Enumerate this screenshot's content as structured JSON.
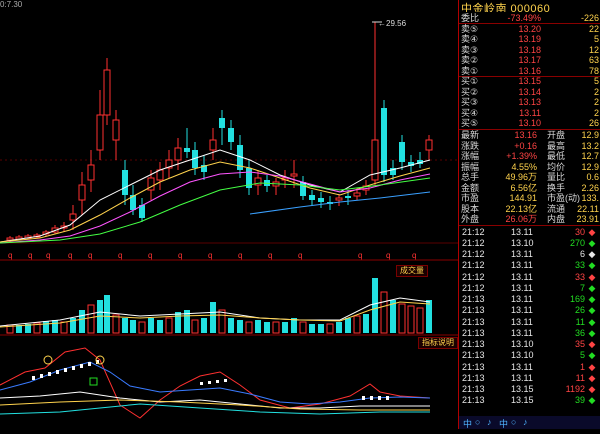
{
  "corner_time": "0:7.30",
  "peak_label": "29.56",
  "volume_tag": "成交量",
  "indicator_tag": "指标说明",
  "q_marks": [
    "q",
    "q",
    "q",
    "q",
    "q",
    "q",
    "q",
    "q",
    "q",
    "q",
    "q",
    "q",
    "q",
    "q",
    "q"
  ],
  "header": {
    "title": "中金岭南 000060"
  },
  "orderbook": [
    {
      "label": "委比",
      "value": "-73.49%",
      "vcls": "red",
      "right": "-226"
    },
    {
      "label": "卖⑤",
      "value": "13.20",
      "vcls": "red",
      "right": "22"
    },
    {
      "label": "卖④",
      "value": "13.19",
      "vcls": "red",
      "right": "5"
    },
    {
      "label": "卖③",
      "value": "13.18",
      "vcls": "red",
      "right": "12"
    },
    {
      "label": "卖②",
      "value": "13.17",
      "vcls": "red",
      "right": "63"
    },
    {
      "label": "卖①",
      "value": "13.16",
      "vcls": "red",
      "right": "78"
    },
    {
      "label": "买①",
      "value": "13.15",
      "vcls": "red",
      "right": "5"
    },
    {
      "label": "买②",
      "value": "13.14",
      "vcls": "red",
      "right": "2"
    },
    {
      "label": "买③",
      "value": "13.13",
      "vcls": "red",
      "right": "2"
    },
    {
      "label": "买④",
      "value": "13.11",
      "vcls": "red",
      "right": "2"
    },
    {
      "label": "买⑤",
      "value": "13.10",
      "vcls": "red",
      "right": "26"
    }
  ],
  "quote": [
    {
      "l1": "最新",
      "v1": "13.16",
      "c1": "red",
      "l2": "开盘",
      "v2": "12.9"
    },
    {
      "l1": "涨跌",
      "v1": "+0.16",
      "c1": "red",
      "l2": "最高",
      "v2": "13.2"
    },
    {
      "l1": "涨幅",
      "v1": "+1.39%",
      "c1": "red",
      "l2": "最低",
      "v2": "12.7"
    },
    {
      "l1": "振幅",
      "v1": "4.55%",
      "c1": "yellow",
      "l2": "均价",
      "v2": "12.9"
    },
    {
      "l1": "总手",
      "v1": "49.96万",
      "c1": "yellow",
      "l2": "量比",
      "v2": "0.6"
    },
    {
      "l1": "金额",
      "v1": "6.56亿",
      "c1": "yellow",
      "l2": "换手",
      "v2": "2.26"
    },
    {
      "l1": "市盈",
      "v1": "144.91",
      "c1": "yellow",
      "l2": "市盈(动)",
      "v2": "133."
    },
    {
      "l1": "股本",
      "v1": "22.13亿",
      "c1": "yellow",
      "l2": "流通",
      "v2": "22.11"
    },
    {
      "l1": "外盘",
      "v1": "26.06万",
      "c1": "red",
      "l2": "内盘",
      "v2": "23.91"
    }
  ],
  "ticks": [
    {
      "time": "21:12",
      "price": "13.11",
      "vol": "30",
      "vcls": "red",
      "arrow": "◆",
      "acls": "red"
    },
    {
      "time": "21:12",
      "price": "13.10",
      "vol": "270",
      "vcls": "green",
      "arrow": "◆",
      "acls": "green"
    },
    {
      "time": "21:12",
      "price": "13.11",
      "vol": "6",
      "vcls": "white",
      "arrow": "◆",
      "acls": "white"
    },
    {
      "time": "21:12",
      "price": "13.11",
      "vol": "33",
      "vcls": "green",
      "arrow": "◆",
      "acls": "green"
    },
    {
      "time": "21:12",
      "price": "13.11",
      "vol": "33",
      "vcls": "red",
      "arrow": "◆",
      "acls": "red"
    },
    {
      "time": "21:12",
      "price": "13.11",
      "vol": "7",
      "vcls": "green",
      "arrow": "◆",
      "acls": "green"
    },
    {
      "time": "21:13",
      "price": "13.11",
      "vol": "169",
      "vcls": "green",
      "arrow": "◆",
      "acls": "green"
    },
    {
      "time": "21:13",
      "price": "13.11",
      "vol": "26",
      "vcls": "green",
      "arrow": "◆",
      "acls": "green"
    },
    {
      "time": "21:13",
      "price": "13.11",
      "vol": "11",
      "vcls": "green",
      "arrow": "◆",
      "acls": "green"
    },
    {
      "time": "21:13",
      "price": "13.11",
      "vol": "36",
      "vcls": "green",
      "arrow": "◆",
      "acls": "green"
    },
    {
      "time": "21:13",
      "price": "13.10",
      "vol": "35",
      "vcls": "red",
      "arrow": "◆",
      "acls": "red"
    },
    {
      "time": "21:13",
      "price": "13.10",
      "vol": "5",
      "vcls": "green",
      "arrow": "◆",
      "acls": "green"
    },
    {
      "time": "21:13",
      "price": "13.11",
      "vol": "1",
      "vcls": "red",
      "arrow": "◆",
      "acls": "red"
    },
    {
      "time": "21:13",
      "price": "13.11",
      "vol": "11",
      "vcls": "red",
      "arrow": "◆",
      "acls": "red"
    },
    {
      "time": "21:13",
      "price": "13.15",
      "vol": "1192",
      "vcls": "red",
      "arrow": "◆",
      "acls": "red"
    },
    {
      "time": "21:13",
      "price": "13.15",
      "vol": "39",
      "vcls": "green",
      "arrow": "◆",
      "acls": "green"
    }
  ],
  "bottom_icons": [
    "中",
    "○",
    "♪",
    "中",
    "○",
    "♪"
  ]
}
